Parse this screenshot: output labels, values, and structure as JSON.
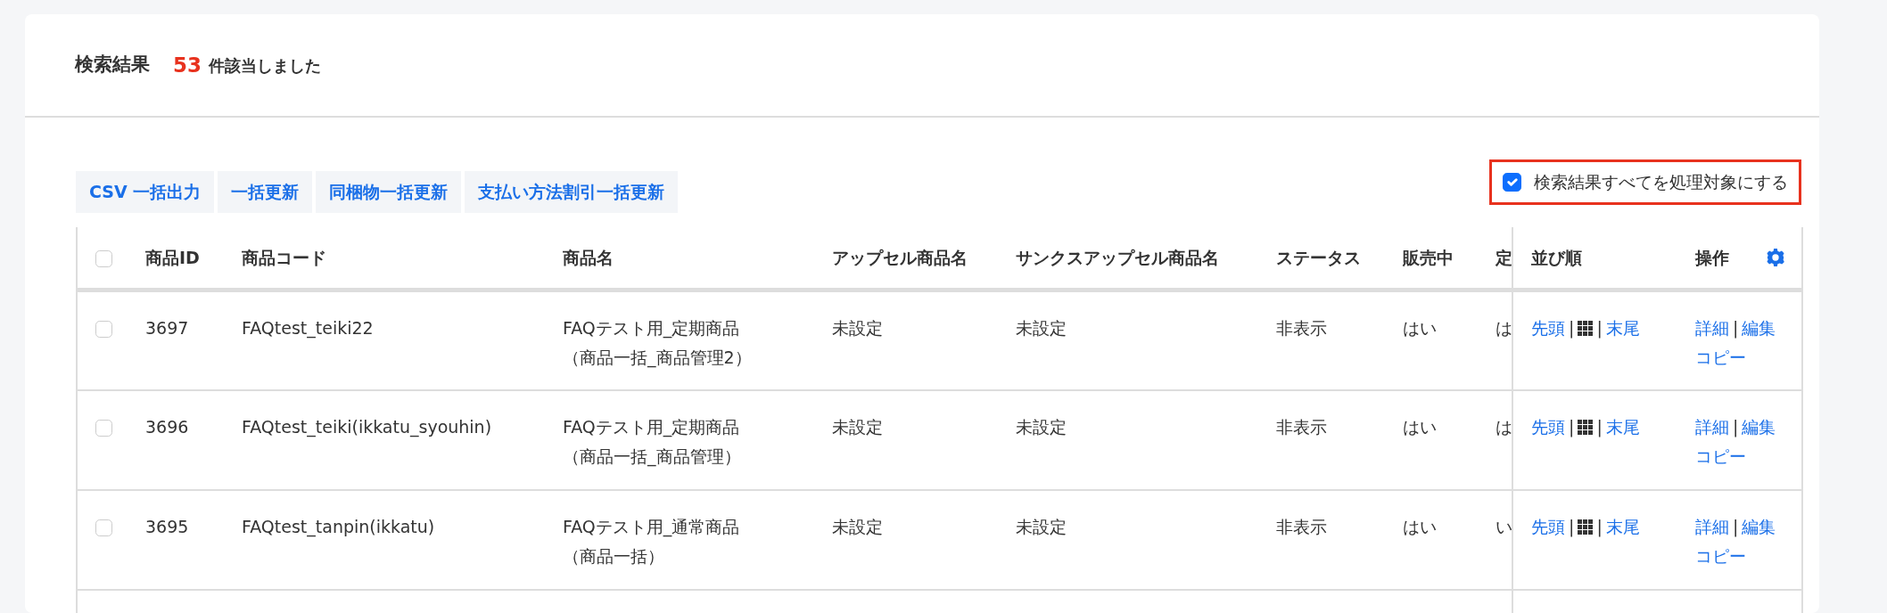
{
  "header": {
    "title": "検索結果",
    "count": "53",
    "count_suffix": "件該当しました"
  },
  "toolbar": {
    "buttons": [
      "CSV 一括出力",
      "一括更新",
      "同梱物一括更新",
      "支払い方法割引一括更新"
    ]
  },
  "select_all_results": {
    "label": "検索結果すべてを処理対象にする",
    "checked": true
  },
  "table": {
    "header_checkbox": {
      "checked": false
    },
    "columns": [
      "商品ID",
      "商品コード",
      "商品名",
      "アップセル商品名",
      "サンクスアップセル商品名",
      "ステータス",
      "販売中",
      "定"
    ],
    "sort_column": "並び順",
    "actions_column": "操作",
    "rows": [
      {
        "checked": false,
        "id": "3697",
        "code": "FAQtest_teiki22",
        "name": [
          "FAQテスト用_定期商品",
          "（商品一括_商品管理2）"
        ],
        "upsell": "未設定",
        "thanks_upsell": "未設定",
        "status": "非表示",
        "on_sale": "はい",
        "column_9": "は",
        "sort_items": [
          {
            "kind": "link",
            "text": "先頭"
          },
          {
            "kind": "separator",
            "text": "|"
          },
          {
            "kind": "grid_icon"
          },
          {
            "kind": "separator",
            "text": "|"
          },
          {
            "kind": "link",
            "text": "末尾"
          }
        ],
        "actions": [
          {
            "kind": "link",
            "text": "詳細"
          },
          {
            "kind": "separator",
            "text": "|"
          },
          {
            "kind": "link",
            "text": "編集"
          },
          {
            "kind": "break"
          },
          {
            "kind": "link",
            "text": "コピー"
          }
        ]
      },
      {
        "checked": false,
        "id": "3696",
        "code": "FAQtest_teiki(ikkatu_syouhin)",
        "name": [
          "FAQテスト用_定期商品",
          "（商品一括_商品管理）"
        ],
        "upsell": "未設定",
        "thanks_upsell": "未設定",
        "status": "非表示",
        "on_sale": "はい",
        "column_9": "は",
        "sort_items": [
          {
            "kind": "link",
            "text": "先頭"
          },
          {
            "kind": "separator",
            "text": "|"
          },
          {
            "kind": "grid_icon"
          },
          {
            "kind": "separator",
            "text": "|"
          },
          {
            "kind": "link",
            "text": "末尾"
          }
        ],
        "actions": [
          {
            "kind": "link",
            "text": "詳細"
          },
          {
            "kind": "separator",
            "text": "|"
          },
          {
            "kind": "link",
            "text": "編集"
          },
          {
            "kind": "break"
          },
          {
            "kind": "link",
            "text": "コピー"
          }
        ]
      },
      {
        "checked": false,
        "id": "3695",
        "code": "FAQtest_tanpin(ikkatu)",
        "name": [
          "FAQテスト用_通常商品",
          "（商品一括）"
        ],
        "upsell": "未設定",
        "thanks_upsell": "未設定",
        "status": "非表示",
        "on_sale": "はい",
        "column_9": "い",
        "sort_items": [
          {
            "kind": "link",
            "text": "先頭"
          },
          {
            "kind": "separator",
            "text": "|"
          },
          {
            "kind": "grid_icon"
          },
          {
            "kind": "separator",
            "text": "|"
          },
          {
            "kind": "link",
            "text": "末尾"
          }
        ],
        "actions": [
          {
            "kind": "link",
            "text": "詳細"
          },
          {
            "kind": "separator",
            "text": "|"
          },
          {
            "kind": "link",
            "text": "編集"
          },
          {
            "kind": "break"
          },
          {
            "kind": "link",
            "text": "コピー"
          }
        ]
      }
    ]
  }
}
